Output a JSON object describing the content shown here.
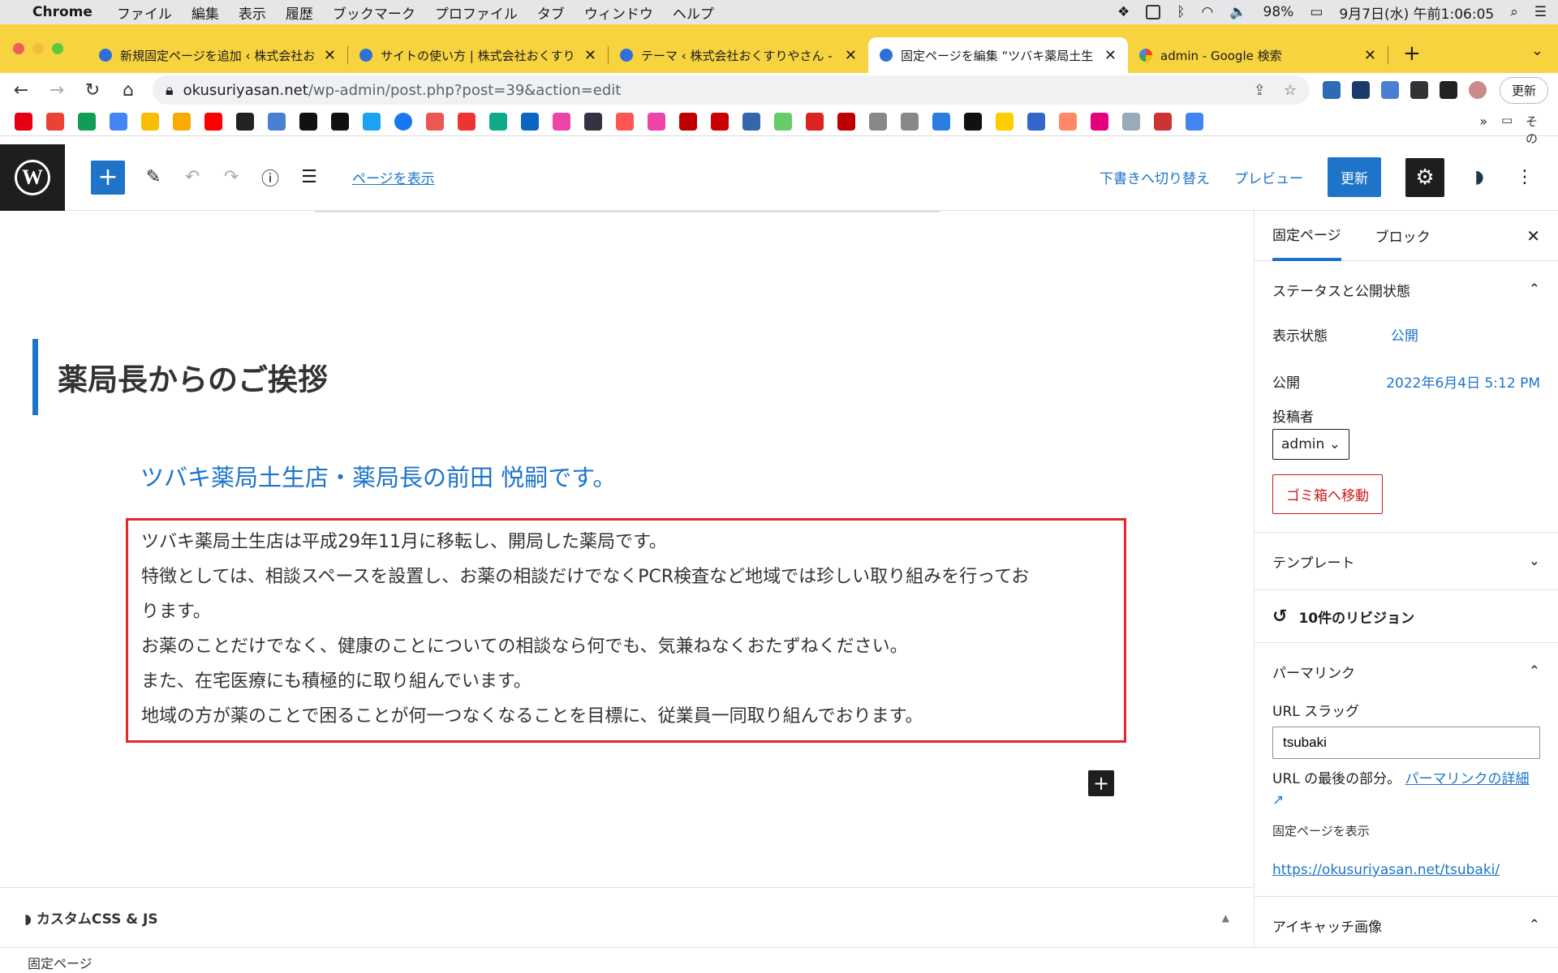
{
  "menubar": {
    "app": "Chrome",
    "items": [
      "ファイル",
      "編集",
      "表示",
      "履歴",
      "ブックマーク",
      "プロファイル",
      "タブ",
      "ウィンドウ",
      "ヘルプ"
    ],
    "battery": "98%",
    "datetime": "9月7日(水) 午前1:06:05"
  },
  "tabs": [
    {
      "title": "新規固定ページを追加 ‹ 株式会社お"
    },
    {
      "title": "サイトの使い方 | 株式会社おくすり"
    },
    {
      "title": "テーマ ‹ 株式会社おくすりやさん -"
    },
    {
      "title": "固定ページを編集 “ツバキ薬局土生"
    },
    {
      "title": "admin - Google 検索"
    }
  ],
  "address": {
    "host": "okusuriyasan.net",
    "path": "/wp-admin/post.php?post=39&action=edit",
    "update_label": "更新"
  },
  "bookmarks": {
    "other_label": "その他のブックマーク"
  },
  "toolbar": {
    "view_page": "ページを表示",
    "switch_draft": "下書きへ切り替え",
    "preview": "プレビュー",
    "update": "更新"
  },
  "content": {
    "heading": "薬局長からのご挨拶",
    "subheading": "ツバキ薬局土生店・薬局長の前田 悦嗣です。",
    "paragraph_lines": [
      "ツバキ薬局土生店は平成29年11月に移転し、開局した薬局です。",
      "特徴としては、相談スペースを設置し、お薬の相談だけでなくPCR検査など地域では珍しい取り組みを行ってお",
      "ります。",
      "お薬のことだけでなく、健康のことについての相談なら何でも、気兼ねなくおたずねください。",
      "また、在宅医療にも積極的に取り組んでいます。",
      "地域の方が薬のことで困ることが何一つなくなることを目標に、従業員一同取り組んでおります。"
    ]
  },
  "meta_box": {
    "title": "カスタムCSS & JS"
  },
  "footer": {
    "breadcrumb": "固定ページ"
  },
  "sidebar": {
    "tab_page": "固定ページ",
    "tab_block": "ブロック",
    "status_title": "ステータスと公開状態",
    "visibility_label": "表示状態",
    "visibility_value": "公開",
    "publish_label": "公開",
    "publish_value": "2022年6月4日 5:12 PM",
    "author_label": "投稿者",
    "author_value": "admin",
    "trash": "ゴミ箱へ移動",
    "template_title": "テンプレート",
    "revisions": "10件のリビジョン",
    "permalink_title": "パーマリンク",
    "slug_label": "URL スラッグ",
    "slug_value": "tsubaki",
    "slug_help": "URL の最後の部分。",
    "slug_help_link": "パーマリンクの詳細",
    "view_page_label": "固定ページを表示",
    "page_url": "https://okusuriyasan.net/tsubaki/",
    "featured_title": "アイキャッチ画像"
  }
}
